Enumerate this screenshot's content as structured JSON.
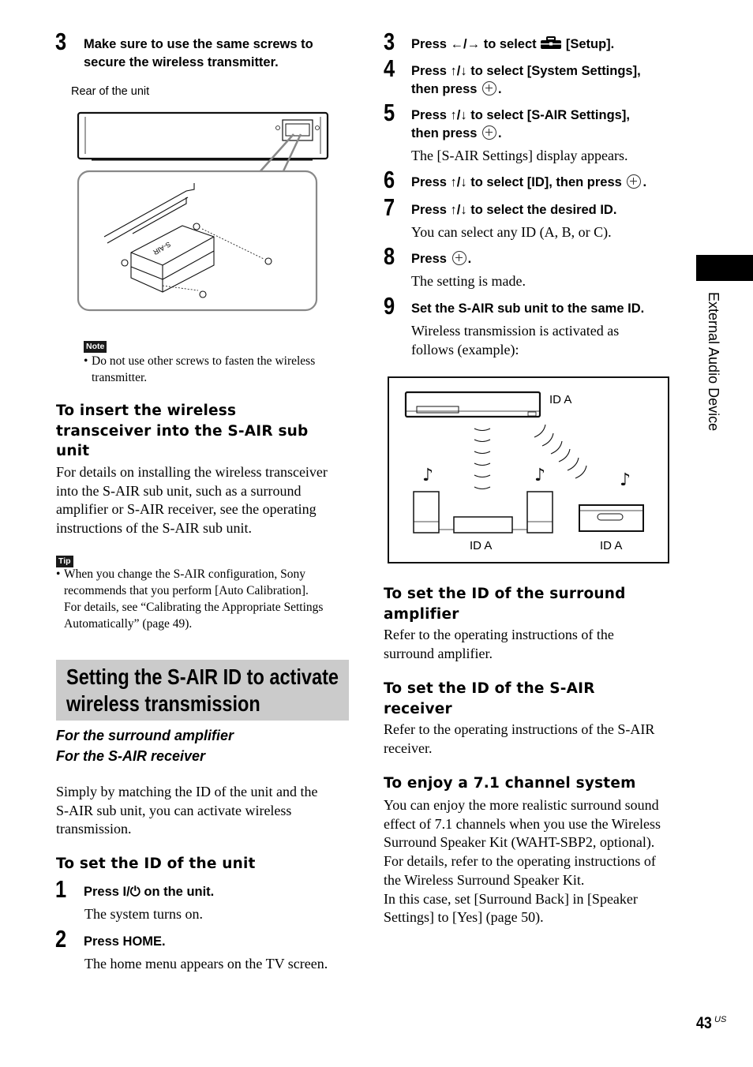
{
  "left_column": {
    "step3": {
      "number": "3",
      "line1": "Make sure to use the same screws to",
      "line2": "secure the wireless transmitter."
    },
    "figure_caption": "Rear of the unit",
    "figure_label": "S-AIR",
    "note": {
      "badge": "Note",
      "bullet": "•",
      "line1": "Do not use other screws to fasten the wireless",
      "line2": "transmitter."
    },
    "insert_heading": {
      "line1": "To insert the wireless",
      "line2": "transceiver into the S-AIR sub",
      "line3": "unit"
    },
    "insert_body": [
      "For details on installing the wireless transceiver",
      "into the S-AIR sub unit, such as a surround",
      "amplifier or S-AIR receiver, see the operating",
      "instructions of the S-AIR sub unit."
    ],
    "tip": {
      "badge": "Tip",
      "bullet": "•",
      "lines": [
        "When you change the S-AIR configuration, Sony",
        "recommends that you perform [Auto Calibration].",
        "For details, see “Calibrating the Appropriate Settings",
        "Automatically” (page 49)."
      ]
    },
    "section_title": {
      "line1": "Setting the S-AIR ID to activate",
      "line2": "wireless transmission"
    },
    "applies_to": [
      "For the surround amplifier",
      "For the S-AIR receiver"
    ],
    "intro": [
      "Simply by matching the ID of the unit and the",
      "S-AIR sub unit, you can activate wireless",
      "transmission."
    ],
    "unit_heading": "To set the ID of the unit",
    "step1": {
      "number": "1",
      "pre": "Press ",
      "symbol": "I/⏻",
      "post": " on the unit.",
      "result": "The system turns on."
    },
    "step2": {
      "number": "2",
      "text": "Press HOME.",
      "result": "The home menu appears on the TV screen."
    }
  },
  "right_column": {
    "step3": {
      "number": "3",
      "pre": "Press ←/→ to select ",
      "icon": "toolbox-icon",
      "post": " [Setup]."
    },
    "step4": {
      "number": "4",
      "line1": "Press ↑/↓ to select [System Settings],",
      "line2_pre": "then press",
      "line2_post": "."
    },
    "step5": {
      "number": "5",
      "line1": "Press ↑/↓ to select [S-AIR Settings],",
      "line2_pre": "then press",
      "line2_post": ".",
      "result": "The [S-AIR Settings] display appears."
    },
    "step6": {
      "number": "6",
      "pre": "Press ↑/↓ to select [ID], then press",
      "post": "."
    },
    "step7": {
      "number": "7",
      "text": "Press ↑/↓ to select the desired ID.",
      "result": "You can select any ID (A, B, or C)."
    },
    "step8": {
      "number": "8",
      "pre": "Press",
      "post": ".",
      "result": "The setting is made."
    },
    "step9": {
      "number": "9",
      "text": "Set the S-AIR sub unit to the same ID.",
      "result1": "Wireless transmission is activated as",
      "result2": "follows (example):"
    },
    "diagram": {
      "main_unit_id": "ID A",
      "amplifier_id": "ID A",
      "receiver_id": "ID A"
    },
    "amp_heading": {
      "line1": "To set the ID of the surround",
      "line2": "amplifier"
    },
    "amp_body": [
      "Refer to the operating instructions of the",
      "surround amplifier."
    ],
    "recv_heading": {
      "line1": "To set the ID of the S-AIR",
      "line2": "receiver"
    },
    "recv_body": [
      "Refer to the operating instructions of the S-AIR",
      "receiver."
    ],
    "enjoy_heading": "To enjoy a 7.1 channel system",
    "enjoy_body": [
      "You can enjoy the more realistic surround sound",
      "effect of 7.1 channels when you use the Wireless",
      "Surround Speaker Kit (WAHT-SBP2, optional).",
      "For details, refer to the operating instructions of",
      "the Wireless Surround Speaker Kit.",
      "In this case, set [Surround Back] in [Speaker",
      "Settings] to [Yes] (page 50)."
    ]
  },
  "side_tab": {
    "label": "External Audio Device"
  },
  "footer": {
    "page_number": "43",
    "page_suffix": "US"
  }
}
